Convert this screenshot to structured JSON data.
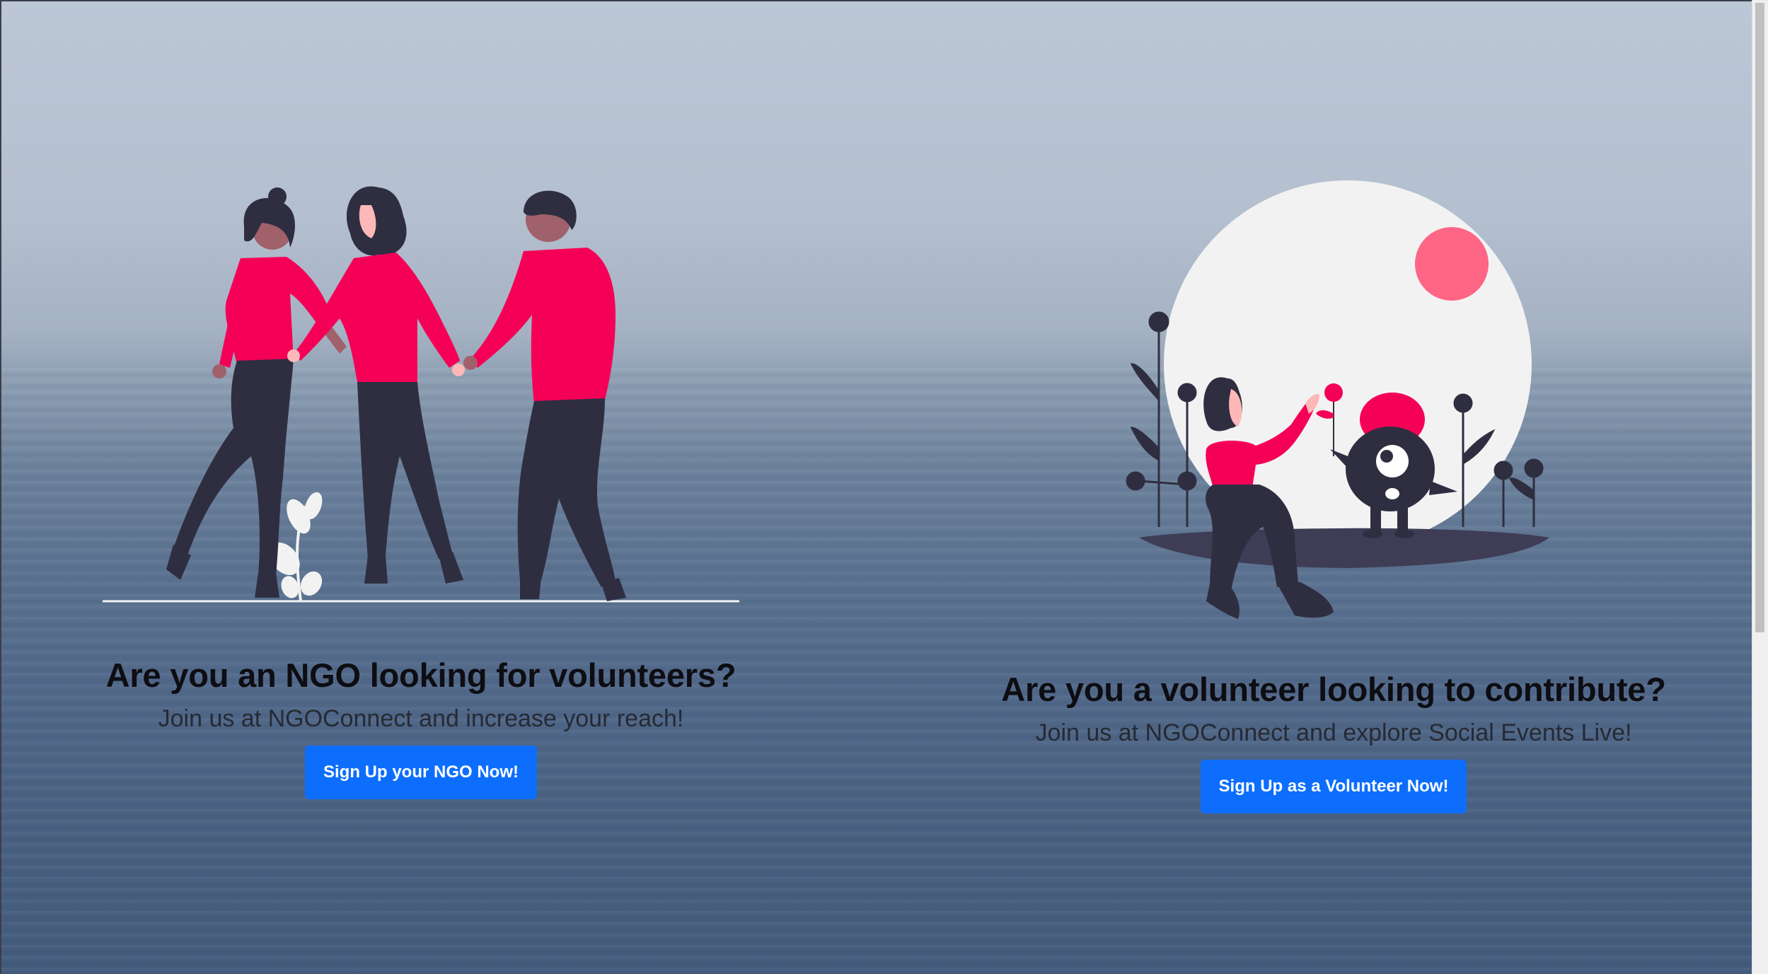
{
  "ngo_section": {
    "heading": "Are you an NGO looking for volunteers?",
    "subheading": "Join us at NGOConnect and increase your reach!",
    "button_label": "Sign Up your NGO Now!"
  },
  "volunteer_section": {
    "heading": "Are you a volunteer looking to contribute?",
    "subheading": "Join us at NGOConnect and explore Social Events Live!",
    "button_label": "Sign Up as a Volunteer Now!"
  },
  "colors": {
    "accent": "#0d6efd",
    "illustration_pink": "#f50057",
    "illustration_dark": "#2f2e41",
    "moon": "#f2f2f2",
    "sun": "#ff6584"
  },
  "background": "sea-fog-photo"
}
